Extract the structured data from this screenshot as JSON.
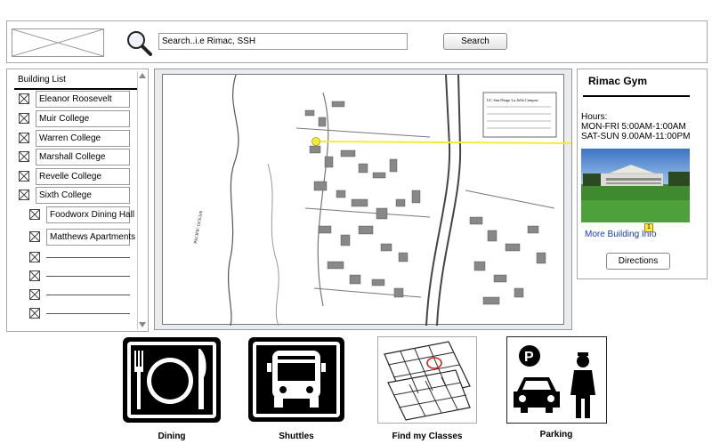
{
  "search": {
    "placeholder": "Search..i.e Rimac, SSH",
    "button_label": "Search"
  },
  "building_list": {
    "title": "Building List",
    "items": [
      {
        "label": "Eleanor Roosevelt"
      },
      {
        "label": "Muir College"
      },
      {
        "label": "Warren College"
      },
      {
        "label": "Marshall College"
      },
      {
        "label": "Revelle College"
      },
      {
        "label": "Sixth College"
      },
      {
        "label": "Foodworx Dining Hall"
      },
      {
        "label": "Matthews Apartments"
      }
    ]
  },
  "info_panel": {
    "title": "Rimac Gym",
    "hours_label": "Hours:",
    "hours_weekday": "MON-FRI 5:00AM-1:00AM",
    "hours_weekend": "SAT-SUN 9.00AM-11:00PM",
    "more_link": "More Building Info",
    "badge": "1",
    "directions_label": "Directions"
  },
  "map": {
    "ocean_label": "PACIFIC OCEAN",
    "legend_title": "UC San Diego La Jolla Campus",
    "marker_color": "#f5ec3a"
  },
  "bottom_nav": {
    "dining": "Dining",
    "shuttles": "Shuttles",
    "find_classes": "Find my Classes",
    "parking": "Parking"
  }
}
